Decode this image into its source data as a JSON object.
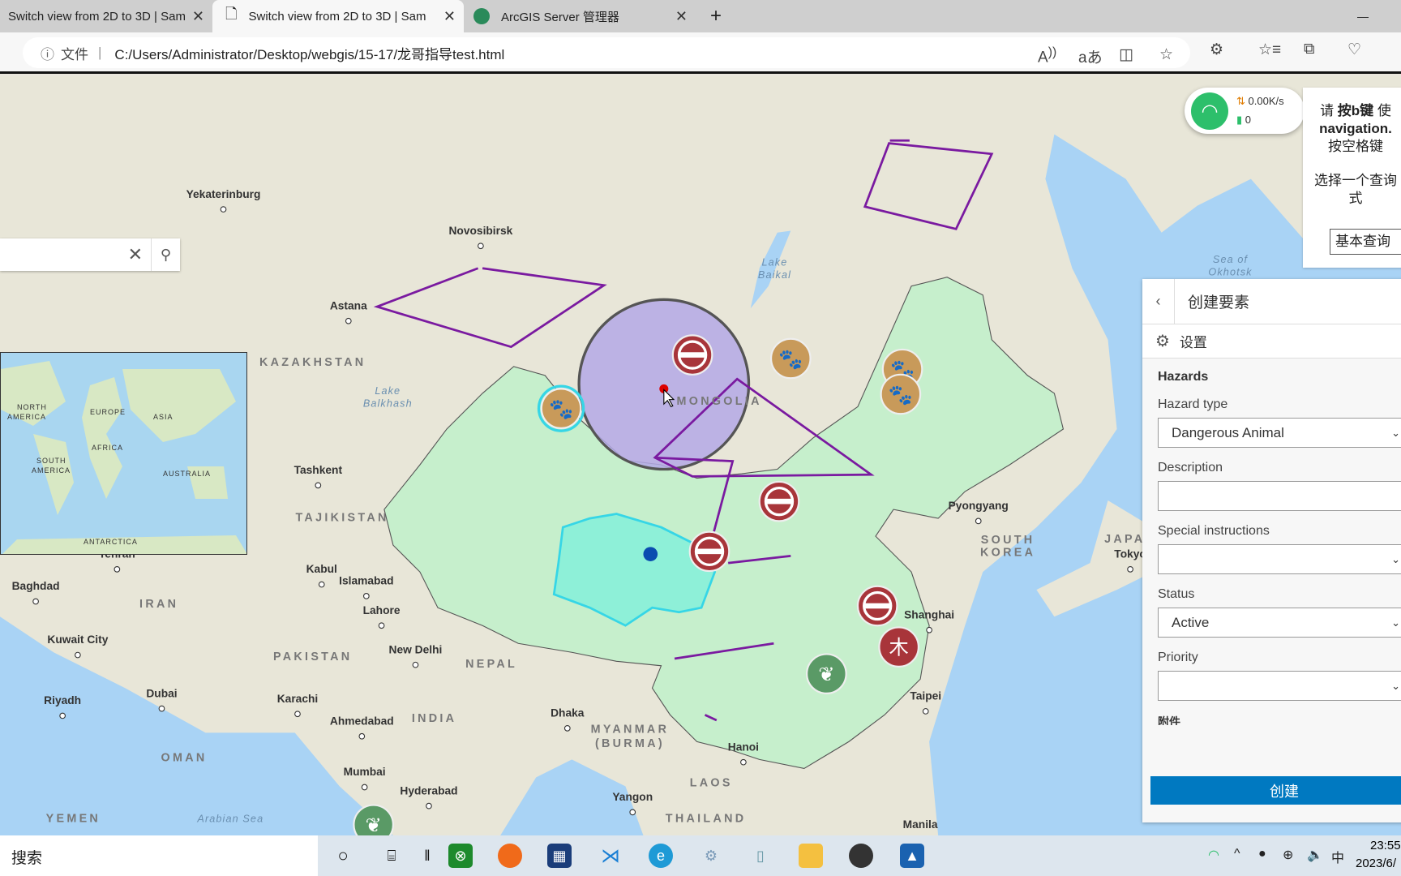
{
  "browser": {
    "tabs": [
      {
        "title": "Switch view from 2D to 3D | Sam",
        "active": false
      },
      {
        "title": "Switch view from 2D to 3D | Sam",
        "active": true
      },
      {
        "title": "ArcGIS Server 管理器",
        "active": false
      }
    ],
    "close_glyph": "✕",
    "new_tab_glyph": "+",
    "minimize_glyph": "—",
    "address": {
      "info_label": "文件",
      "url": "C:/Users/Administrator/Desktop/webgis/15-17/龙哥指导test.html"
    }
  },
  "map": {
    "search": {
      "clear_glyph": "✕",
      "search_glyph": "⚲"
    },
    "labels": {
      "cities": [
        "Yekaterinburg",
        "Novosibirsk",
        "Astana",
        "Tashkent",
        "Tehran",
        "Kabul",
        "Islamabad",
        "Baghdad",
        "Lahore",
        "Kuwait City",
        "New Delhi",
        "Riyadh",
        "Dubai",
        "Karachi",
        "Ahmedabad",
        "Dhaka",
        "Mumbai",
        "Hyderabad",
        "Yangon",
        "Hanoi",
        "Taipei",
        "Manila",
        "Pyongyang",
        "Tokyo",
        "Shanghai"
      ],
      "countries": [
        "KAZAKHSTAN",
        "MONGOLIA",
        "TAJIKISTAN",
        "IRAN",
        "PAKISTAN",
        "NEPAL",
        "INDIA",
        "MYANMAR",
        "(BURMA)",
        "OMAN",
        "THAILAND",
        "YEMEN",
        "LAOS",
        "SOUTH",
        "KOREA",
        "JAPAN"
      ],
      "water": [
        "Lake",
        "Balkhash",
        "Lake",
        "Baikal",
        "Sea of",
        "Okhotsk",
        "Arabian Sea"
      ]
    },
    "overview_labels": [
      "NORTH",
      "AMERICA",
      "EUROPE",
      "ASIA",
      "AFRICA",
      "SOUTH",
      "AMERICA",
      "AUSTRALIA",
      "ANTARCTICA"
    ],
    "colors": {
      "province_fill": "#c6efcc",
      "selected_fill": "#8ef0d8",
      "selected_stroke": "#36d6e6",
      "buffer_fill": "#b4a8e6",
      "lines": "#7a1aa0",
      "no_entry": "#a8353a",
      "bear": "#c89a5a",
      "leaf": "#5a9a66"
    }
  },
  "network_widget": {
    "speed": "0.00K/s",
    "count": "0"
  },
  "query_panel": {
    "line1_a": "请",
    "line1_b": "按b键",
    "line1_c": "使",
    "line2": "navigation.",
    "line3": "按空格键",
    "line4": "选择一个查询",
    "line5": "式",
    "select_value": "基本查询"
  },
  "editor": {
    "title": "创建要素",
    "settings": "设置",
    "section": "Hazards",
    "fields": [
      {
        "label": "Hazard type",
        "value": "Dangerous Animal",
        "type": "select"
      },
      {
        "label": "Description",
        "value": "",
        "type": "text"
      },
      {
        "label": "Special instructions",
        "value": "",
        "type": "select"
      },
      {
        "label": "Status",
        "value": "Active",
        "type": "select"
      },
      {
        "label": "Priority",
        "value": "",
        "type": "select"
      }
    ],
    "attachments": "附件",
    "create": "创建"
  },
  "taskbar": {
    "search": "搜索",
    "time": "23:55",
    "date": "2023/6/",
    "ime": "中"
  }
}
